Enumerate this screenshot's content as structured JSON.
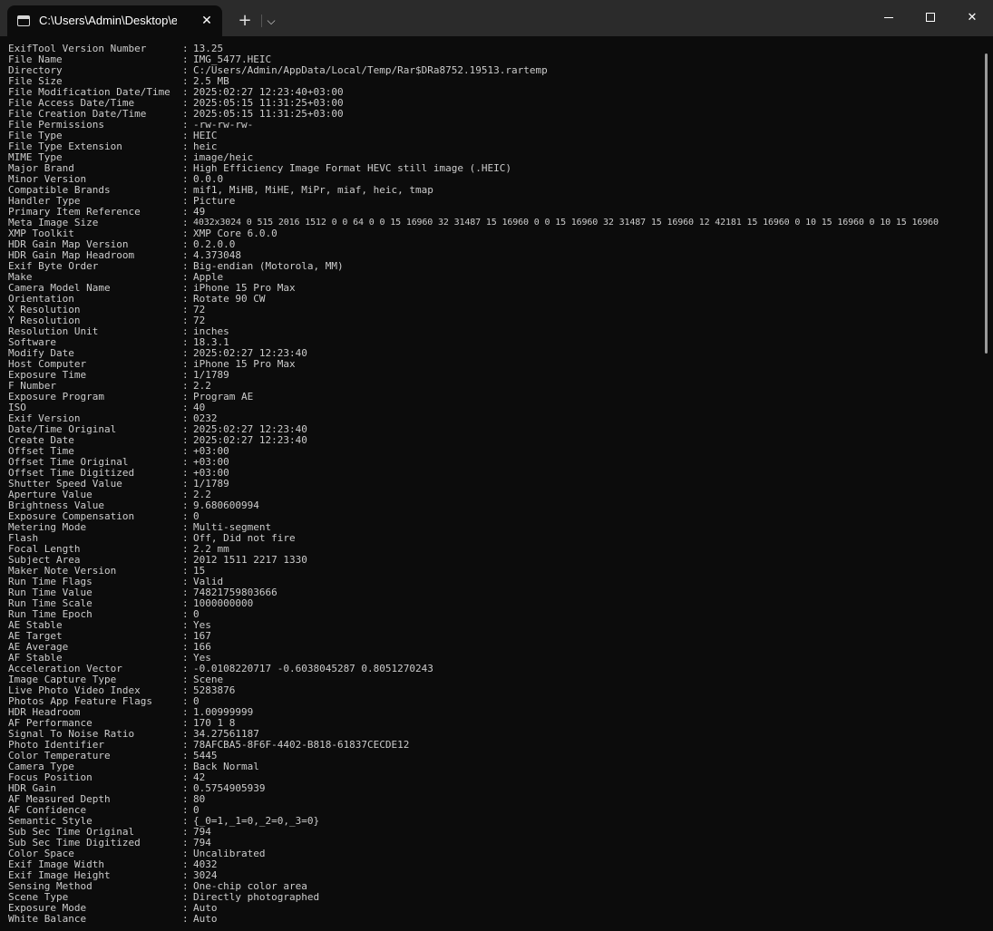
{
  "tab": {
    "title": "C:\\Users\\Admin\\Desktop\\exift",
    "close_glyph": "✕",
    "new_tab_glyph": "+",
    "dropdown_glyph": "⌵"
  },
  "window_controls": {
    "close_glyph": "✕"
  },
  "rows": [
    {
      "k": "ExifTool Version Number",
      "v": "13.25"
    },
    {
      "k": "File Name",
      "v": "IMG_5477.HEIC"
    },
    {
      "k": "Directory",
      "v": "C:/Users/Admin/AppData/Local/Temp/Rar$DRa8752.19513.rartemp"
    },
    {
      "k": "File Size",
      "v": "2.5 MB"
    },
    {
      "k": "File Modification Date/Time",
      "v": "2025:02:27 12:23:40+03:00"
    },
    {
      "k": "File Access Date/Time",
      "v": "2025:05:15 11:31:25+03:00"
    },
    {
      "k": "File Creation Date/Time",
      "v": "2025:05:15 11:31:25+03:00"
    },
    {
      "k": "File Permissions",
      "v": "-rw-rw-rw-"
    },
    {
      "k": "File Type",
      "v": "HEIC"
    },
    {
      "k": "File Type Extension",
      "v": "heic"
    },
    {
      "k": "MIME Type",
      "v": "image/heic"
    },
    {
      "k": "Major Brand",
      "v": "High Efficiency Image Format HEVC still image (.HEIC)"
    },
    {
      "k": "Minor Version",
      "v": "0.0.0"
    },
    {
      "k": "Compatible Brands",
      "v": "mif1, MiHB, MiHE, MiPr, miaf, heic, tmap"
    },
    {
      "k": "Handler Type",
      "v": "Picture"
    },
    {
      "k": "Primary Item Reference",
      "v": "49"
    },
    {
      "k": "Meta Image Size",
      "v": "4032x3024 0 515 2016 1512 0 0 64 0 0 15 16960 32 31487 15 16960 0 0 15 16960 32 31487 15 16960 12 42181 15 16960 0 10 15 16960 0 10 15 16960",
      "small": true
    },
    {
      "k": "XMP Toolkit",
      "v": "XMP Core 6.0.0"
    },
    {
      "k": "HDR Gain Map Version",
      "v": "0.2.0.0"
    },
    {
      "k": "HDR Gain Map Headroom",
      "v": "4.373048"
    },
    {
      "k": "Exif Byte Order",
      "v": "Big-endian (Motorola, MM)"
    },
    {
      "k": "Make",
      "v": "Apple"
    },
    {
      "k": "Camera Model Name",
      "v": "iPhone 15 Pro Max"
    },
    {
      "k": "Orientation",
      "v": "Rotate 90 CW"
    },
    {
      "k": "X Resolution",
      "v": "72"
    },
    {
      "k": "Y Resolution",
      "v": "72"
    },
    {
      "k": "Resolution Unit",
      "v": "inches"
    },
    {
      "k": "Software",
      "v": "18.3.1"
    },
    {
      "k": "Modify Date",
      "v": "2025:02:27 12:23:40"
    },
    {
      "k": "Host Computer",
      "v": "iPhone 15 Pro Max"
    },
    {
      "k": "Exposure Time",
      "v": "1/1789"
    },
    {
      "k": "F Number",
      "v": "2.2"
    },
    {
      "k": "Exposure Program",
      "v": "Program AE"
    },
    {
      "k": "ISO",
      "v": "40"
    },
    {
      "k": "Exif Version",
      "v": "0232"
    },
    {
      "k": "Date/Time Original",
      "v": "2025:02:27 12:23:40"
    },
    {
      "k": "Create Date",
      "v": "2025:02:27 12:23:40"
    },
    {
      "k": "Offset Time",
      "v": "+03:00"
    },
    {
      "k": "Offset Time Original",
      "v": "+03:00"
    },
    {
      "k": "Offset Time Digitized",
      "v": "+03:00"
    },
    {
      "k": "Shutter Speed Value",
      "v": "1/1789"
    },
    {
      "k": "Aperture Value",
      "v": "2.2"
    },
    {
      "k": "Brightness Value",
      "v": "9.680600994"
    },
    {
      "k": "Exposure Compensation",
      "v": "0"
    },
    {
      "k": "Metering Mode",
      "v": "Multi-segment"
    },
    {
      "k": "Flash",
      "v": "Off, Did not fire"
    },
    {
      "k": "Focal Length",
      "v": "2.2 mm"
    },
    {
      "k": "Subject Area",
      "v": "2012 1511 2217 1330"
    },
    {
      "k": "Maker Note Version",
      "v": "15"
    },
    {
      "k": "Run Time Flags",
      "v": "Valid"
    },
    {
      "k": "Run Time Value",
      "v": "74821759803666"
    },
    {
      "k": "Run Time Scale",
      "v": "1000000000"
    },
    {
      "k": "Run Time Epoch",
      "v": "0"
    },
    {
      "k": "AE Stable",
      "v": "Yes"
    },
    {
      "k": "AE Target",
      "v": "167"
    },
    {
      "k": "AE Average",
      "v": "166"
    },
    {
      "k": "AF Stable",
      "v": "Yes"
    },
    {
      "k": "Acceleration Vector",
      "v": "-0.0108220717 -0.6038045287 0.8051270243"
    },
    {
      "k": "Image Capture Type",
      "v": "Scene"
    },
    {
      "k": "Live Photo Video Index",
      "v": "5283876"
    },
    {
      "k": "Photos App Feature Flags",
      "v": "0"
    },
    {
      "k": "HDR Headroom",
      "v": "1.00999999"
    },
    {
      "k": "AF Performance",
      "v": "170 1 8"
    },
    {
      "k": "Signal To Noise Ratio",
      "v": "34.27561187"
    },
    {
      "k": "Photo Identifier",
      "v": "78AFCBA5-8F6F-4402-B818-61837CECDE12"
    },
    {
      "k": "Color Temperature",
      "v": "5445"
    },
    {
      "k": "Camera Type",
      "v": "Back Normal"
    },
    {
      "k": "Focus Position",
      "v": "42"
    },
    {
      "k": "HDR Gain",
      "v": "0.5754905939"
    },
    {
      "k": "AF Measured Depth",
      "v": "80"
    },
    {
      "k": "AF Confidence",
      "v": "0"
    },
    {
      "k": "Semantic Style",
      "v": "{_0=1,_1=0,_2=0,_3=0}"
    },
    {
      "k": "Sub Sec Time Original",
      "v": "794"
    },
    {
      "k": "Sub Sec Time Digitized",
      "v": "794"
    },
    {
      "k": "Color Space",
      "v": "Uncalibrated"
    },
    {
      "k": "Exif Image Width",
      "v": "4032"
    },
    {
      "k": "Exif Image Height",
      "v": "3024"
    },
    {
      "k": "Sensing Method",
      "v": "One-chip color area"
    },
    {
      "k": "Scene Type",
      "v": "Directly photographed"
    },
    {
      "k": "Exposure Mode",
      "v": "Auto"
    },
    {
      "k": "White Balance",
      "v": "Auto"
    }
  ],
  "separator": ":"
}
